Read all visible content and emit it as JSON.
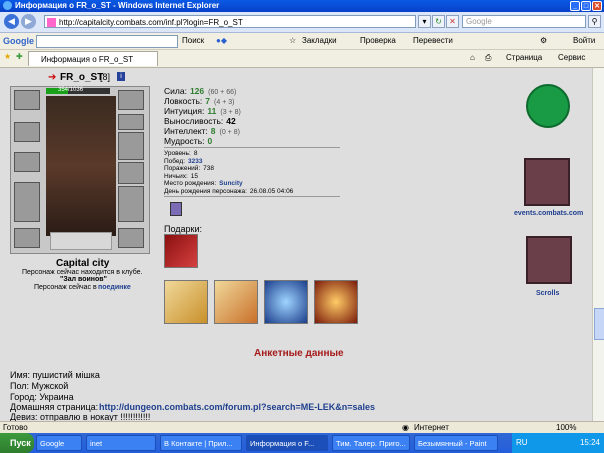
{
  "window": {
    "title": "Информация о FR_o_ST - Windows Internet Explorer"
  },
  "addressbar": {
    "url": "http://capitalcity.combats.com/inf.pl?login=FR_o_ST",
    "search_placeholder": "Google"
  },
  "google_toolbar": {
    "brand": "Google",
    "search_btn": "Поиск",
    "bookmarks": "Закладки",
    "check": "Проверка",
    "translate": "Перевести",
    "login": "Войти"
  },
  "tab": {
    "label": "Информация о FR_o_ST"
  },
  "command_bar": {
    "page": "Страница",
    "service": "Сервис"
  },
  "character": {
    "name": "FR_o_ST",
    "level": "[8]",
    "hp": "354/1036",
    "stats": [
      {
        "label": "Сила:",
        "value": "126",
        "extra": "(60 + 66)"
      },
      {
        "label": "Ловкость:",
        "value": "7",
        "extra": "(4 + 3)"
      },
      {
        "label": "Интуиция:",
        "value": "11",
        "extra": "(3 + 8)"
      },
      {
        "label": "Выносливость:",
        "value": "42",
        "extra": ""
      },
      {
        "label": "Интеллект:",
        "value": "8",
        "extra": "(0 + 8)"
      },
      {
        "label": "Мудрость:",
        "value": "0",
        "extra": ""
      }
    ],
    "info": [
      {
        "label": "Уровень:",
        "value": "8"
      },
      {
        "label": "Побед:",
        "value": "3233"
      },
      {
        "label": "Поражений:",
        "value": "738"
      },
      {
        "label": "Ничьих:",
        "value": "15"
      },
      {
        "label": "Место рождения:",
        "value": "Suncity"
      },
      {
        "label": "День рождения персонажа:",
        "value": "26.08.05 04:06"
      }
    ],
    "city": "Capital city",
    "location_text": "Персонаж сейчас находится в клубе.",
    "location_room": "\"Зал воинов\"",
    "activity_prefix": "Персонаж сейчас в",
    "activity": "поединке",
    "gifts_label": "Подарки:"
  },
  "side": {
    "events": "events.combats.com",
    "scrolls": "Scrolls"
  },
  "profile": {
    "heading": "Анкетные данные",
    "name": "Имя: пушистий мішка",
    "sex": "Пол: Мужской",
    "city": "Город: Украина",
    "homepage_label": "Домашняя страница:",
    "homepage": "http://dungeon.combats.com/forum.pl?search=ME-LEK&n=sales",
    "motto": "Девиз: отправлю в нокаут !!!!!!!!!!!!"
  },
  "status": {
    "left": "Готово",
    "zone": "Интернет",
    "zoom": "100%"
  },
  "taskbar": {
    "start": "Пуск",
    "items": [
      "Google",
      "inet",
      "В Контакте | Прил...",
      "Информация о F...",
      "Тим. Талер. Приго...",
      "Безымянный - Paint"
    ],
    "lang": "RU",
    "clock": "15:24"
  }
}
